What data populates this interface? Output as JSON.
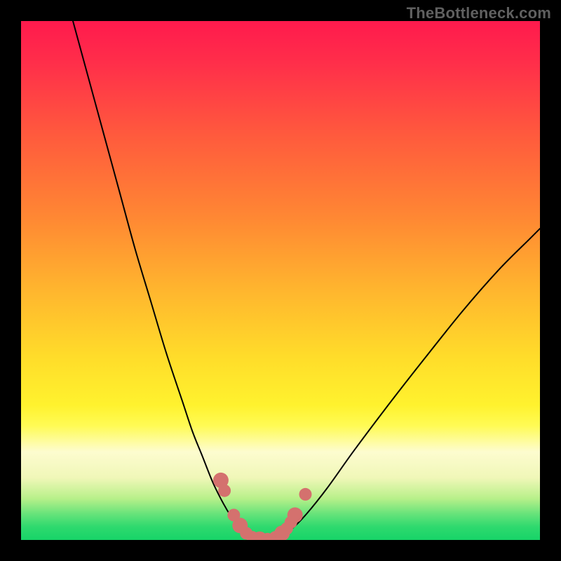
{
  "watermark": "TheBottleneck.com",
  "chart_data": {
    "type": "line",
    "title": "",
    "xlabel": "",
    "ylabel": "",
    "xlim": [
      0,
      100
    ],
    "ylim": [
      0,
      100
    ],
    "series": [
      {
        "name": "left-curve",
        "x": [
          10,
          13,
          16,
          19,
          22,
          25,
          28,
          31,
          33,
          35,
          37,
          39,
          40.5,
          42,
          43.5,
          45
        ],
        "y": [
          100,
          89,
          78,
          67,
          56,
          46,
          36,
          27,
          21,
          16,
          11,
          7,
          4.5,
          2.5,
          1.2,
          0.3
        ]
      },
      {
        "name": "valley-floor",
        "x": [
          45,
          46.5,
          48,
          49.5
        ],
        "y": [
          0.3,
          0.1,
          0.15,
          0.5
        ]
      },
      {
        "name": "right-curve",
        "x": [
          49.5,
          52,
          55,
          59,
          64,
          70,
          77,
          85,
          92,
          98,
          100
        ],
        "y": [
          0.5,
          2,
          5,
          10,
          17,
          25,
          34,
          44,
          52,
          58,
          60
        ]
      }
    ],
    "markers": {
      "name": "highlight-dots",
      "color": "#d4716e",
      "points": [
        {
          "x": 38.5,
          "y": 11.5
        },
        {
          "x": 39.2,
          "y": 9.5
        },
        {
          "x": 41,
          "y": 4.8
        },
        {
          "x": 42.2,
          "y": 2.8
        },
        {
          "x": 43.4,
          "y": 1.3
        },
        {
          "x": 44.6,
          "y": 0.5
        },
        {
          "x": 46.0,
          "y": 0.15
        },
        {
          "x": 47.5,
          "y": 0.15
        },
        {
          "x": 49.0,
          "y": 0.5
        },
        {
          "x": 50.3,
          "y": 1.3
        },
        {
          "x": 51.2,
          "y": 2.2
        },
        {
          "x": 52.0,
          "y": 3.4
        },
        {
          "x": 52.8,
          "y": 4.8
        },
        {
          "x": 54.8,
          "y": 8.8
        }
      ]
    },
    "gradient_stops": [
      {
        "pos": 0,
        "color": "#ff1a4d"
      },
      {
        "pos": 0.22,
        "color": "#ff5a3d"
      },
      {
        "pos": 0.52,
        "color": "#ffb62e"
      },
      {
        "pos": 0.74,
        "color": "#fff22e"
      },
      {
        "pos": 0.85,
        "color": "#fdfccf"
      },
      {
        "pos": 1.0,
        "color": "#17d468"
      }
    ]
  }
}
